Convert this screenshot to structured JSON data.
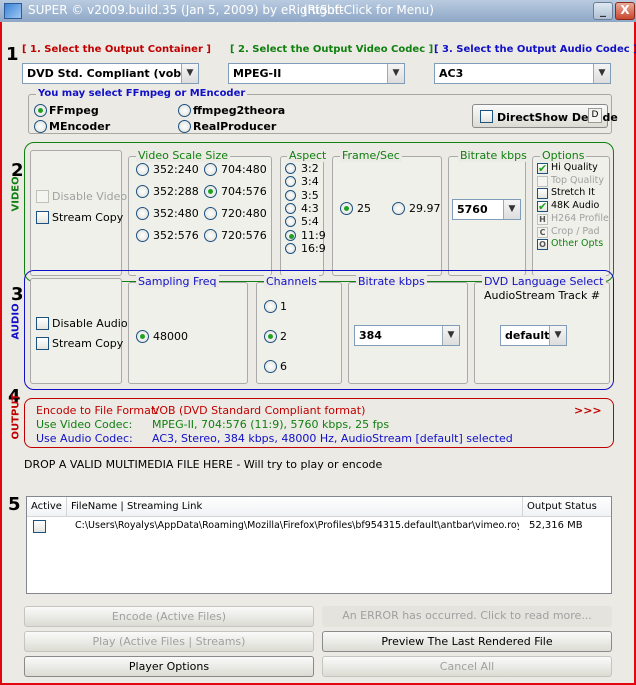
{
  "window": {
    "title": "SUPER © v2009.build.35 (Jan 5, 2009) by eRightSoft",
    "right_click_hint": "(Right-Click for Menu)",
    "min_label": "_",
    "close_label": "X"
  },
  "colors": {
    "container": "#c00000",
    "video": "#108010",
    "audio": "#1010c8",
    "output": "#c00000"
  },
  "section_numbers": [
    "1",
    "2",
    "3",
    "4",
    "5"
  ],
  "top": {
    "container_header": "[ 1.      Select the Output Container ]",
    "video_codec_header": "[ 2.    Select the Output Video Codec ]",
    "audio_codec_header": "[ 3.    Select the Output Audio Codec ]",
    "container_value": "DVD    Std. Compliant (vob)",
    "video_codec_value": "MPEG-II",
    "audio_codec_value": "AC3"
  },
  "encoder": {
    "title": "You may select FFmpeg or MEncoder",
    "options": [
      "FFmpeg",
      "ffmpeg2theora",
      "MEncoder",
      "RealProducer"
    ],
    "selected": "FFmpeg",
    "directshow_label": "DirectShow Decode",
    "directshow_btn": "D"
  },
  "video": {
    "side_label": "VIDEO",
    "disable_video": "Disable Video",
    "stream_copy": "Stream Copy",
    "scale_title": "Video Scale Size",
    "scale_options": [
      "352:240",
      "704:480",
      "352:288",
      "704:576",
      "352:480",
      "720:480",
      "352:576",
      "720:576"
    ],
    "scale_selected": "704:576",
    "aspect_title": "Aspect",
    "aspect_options": [
      "3:2",
      "3:4",
      "3:5",
      "4:3",
      "5:4",
      "11:9",
      "16:9"
    ],
    "aspect_selected": "11:9",
    "fps_title": "Frame/Sec",
    "fps_options": [
      "25",
      "29.97"
    ],
    "fps_selected": "25",
    "bitrate_title": "Bitrate  kbps",
    "bitrate_value": "5760",
    "options_title": "Options",
    "options": [
      {
        "label": "Hi Quality",
        "checked": true,
        "enabled": true
      },
      {
        "label": "Top Quality",
        "checked": false,
        "enabled": false
      },
      {
        "label": "Stretch It",
        "checked": false,
        "enabled": true
      },
      {
        "label": "48K Audio",
        "checked": true,
        "enabled": true
      },
      {
        "label": "H264 Profile",
        "checked": false,
        "enabled": false
      },
      {
        "label": "Crop / Pad",
        "checked": false,
        "enabled": false
      },
      {
        "label": "Other Opts",
        "checked": false,
        "enabled": true
      }
    ],
    "option_btn_letters": [
      "H",
      "C",
      "O"
    ]
  },
  "audio": {
    "side_label": "AUDIO",
    "disable_audio": "Disable Audio",
    "stream_copy": "Stream Copy",
    "sampling_title": "Sampling Freq",
    "sampling_value": "48000",
    "channels_title": "Channels",
    "channels_options": [
      "1",
      "2",
      "6"
    ],
    "channels_selected": "2",
    "bitrate_title": "Bitrate  kbps",
    "bitrate_value": "384",
    "language_title_1": "DVD Language Select",
    "language_title_2": "AudioStream  Track #",
    "language_value": "default"
  },
  "output": {
    "side_label": "OUTPUT",
    "format_label": "Encode to File Format:",
    "format_value": "VOB (DVD Standard Compliant format)",
    "more": ">>>",
    "video_label": "Use Video Codec:",
    "video_value": "MPEG-II,  704:576 (11:9),  5760 kbps,  25 fps",
    "audio_label": "Use Audio Codec:",
    "audio_value": "AC3,  Stereo,  384 kbps,  48000 Hz,  AudioStream [default] selected"
  },
  "drop_hint": "DROP A VALID MULTIMEDIA FILE HERE - Will try to play or encode",
  "file_list": {
    "columns": [
      "Active",
      "FileName  |  Streaming Link",
      "Output Status"
    ],
    "rows": [
      {
        "active": false,
        "file": "C:\\Users\\Royalys\\AppData\\Roaming\\Mozilla\\Firefox\\Profiles\\bf954315.default\\antbar\\vimeo.royaddicti...",
        "status": "52,316 MB"
      }
    ]
  },
  "buttons": {
    "encode": "Encode (Active Files)",
    "error": "An ERROR has occurred. Click to read more...",
    "play": "Play (Active Files | Streams)",
    "preview": "Preview The Last Rendered File",
    "player_options": "Player Options",
    "cancel_all": "Cancel All"
  },
  "icons": {
    "dropdown": "chevron-down-icon",
    "app": "app-icon"
  }
}
